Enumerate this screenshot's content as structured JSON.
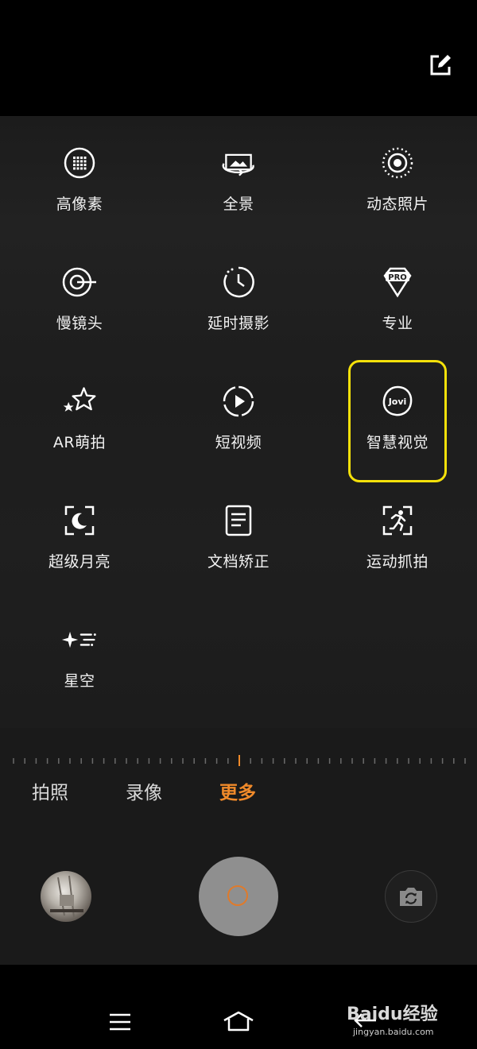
{
  "top_bar": {
    "edit_icon": "edit-icon"
  },
  "modes": [
    {
      "name": "high-pixel",
      "label": "高像素",
      "icon": "grid-circle-icon"
    },
    {
      "name": "panorama",
      "label": "全景",
      "icon": "panorama-icon"
    },
    {
      "name": "live-photo",
      "label": "动态照片",
      "icon": "live-photo-icon"
    },
    {
      "name": "slow-motion",
      "label": "慢镜头",
      "icon": "slow-motion-icon"
    },
    {
      "name": "time-lapse",
      "label": "延时摄影",
      "icon": "timer-icon"
    },
    {
      "name": "pro",
      "label": "专业",
      "icon": "pro-badge-icon"
    },
    {
      "name": "ar-sticker",
      "label": "AR萌拍",
      "icon": "stars-icon"
    },
    {
      "name": "short-video",
      "label": "短视频",
      "icon": "play-circle-icon"
    },
    {
      "name": "smart-vision",
      "label": "智慧视觉",
      "icon": "jovi-icon"
    },
    {
      "name": "super-moon",
      "label": "超级月亮",
      "icon": "moon-frame-icon"
    },
    {
      "name": "doc-correct",
      "label": "文档矫正",
      "icon": "document-icon"
    },
    {
      "name": "sports-capture",
      "label": "运动抓拍",
      "icon": "running-frame-icon"
    },
    {
      "name": "starry-sky",
      "label": "星空",
      "icon": "sparkle-icon"
    }
  ],
  "jovi_text": "Jovi",
  "pro_text": "PRO",
  "tabs": [
    {
      "label": "拍照",
      "active": false
    },
    {
      "label": "录像",
      "active": false
    },
    {
      "label": "更多",
      "active": true
    }
  ],
  "colors": {
    "accent": "#f08a2a",
    "highlight": "#f5e10a"
  },
  "watermark": {
    "text": "Baidu经验",
    "sub": "jingyan.baidu.com"
  }
}
